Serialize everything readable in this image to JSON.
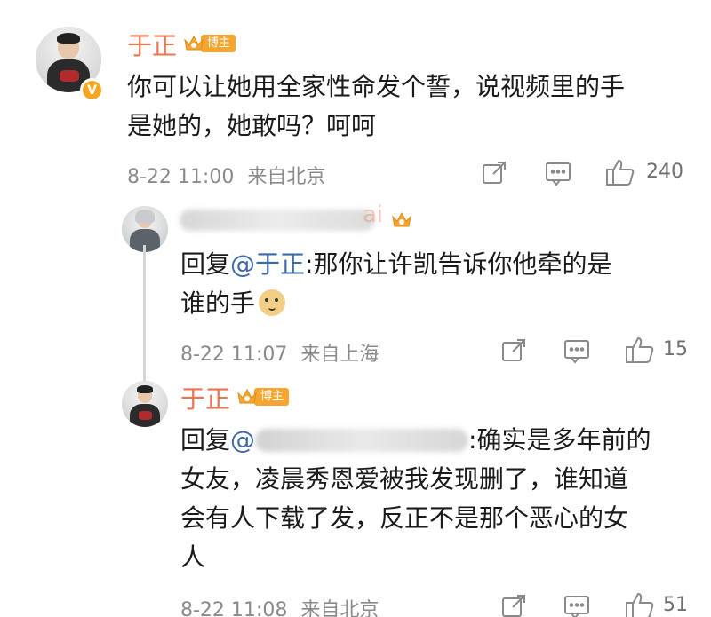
{
  "comments": [
    {
      "user": "于正",
      "role_badge": "博主",
      "text": "你可以让她用全家性命发个誓，说视频里的手是她的，她敢吗？呵呵",
      "text_lines": [
        "你可以让她用全家性命发个誓，说视频里的手",
        "是她的，她敢吗？呵呵"
      ],
      "time": "8-22 11:00",
      "location": "来自北京",
      "likes": "240"
    },
    {
      "user_visible_fragment": "ai",
      "reply_prefix": "回复",
      "mention": "@于正",
      "text_lines_after_mention": ":那你让许凯告诉你他牵的是",
      "text_line2": "谁的手",
      "time": "8-22 11:07",
      "location": "来自上海",
      "likes": "15"
    },
    {
      "user": "于正",
      "role_badge": "博主",
      "reply_prefix": "回复",
      "mention_visible": "@",
      "text_line1_tail": ":确实是多年前的",
      "text_lines": [
        "女友，凌晨秀恩爱被我发现删了，谁知道",
        "会有人下载了发，反正不是那个恶心的女",
        "人"
      ],
      "time": "8-22 11:08",
      "location": "来自北京",
      "likes": "51"
    }
  ],
  "icons": {
    "verified": "verified-v-icon",
    "crown": "crown-icon",
    "share": "share-icon",
    "comment": "comment-icon",
    "like": "thumbs-up-icon",
    "doge": "doge-emoji-icon"
  },
  "colors": {
    "name": "#eb7350",
    "mention": "#3b6aa7",
    "badge": "#f6a531",
    "meta": "#8a8a8a"
  }
}
